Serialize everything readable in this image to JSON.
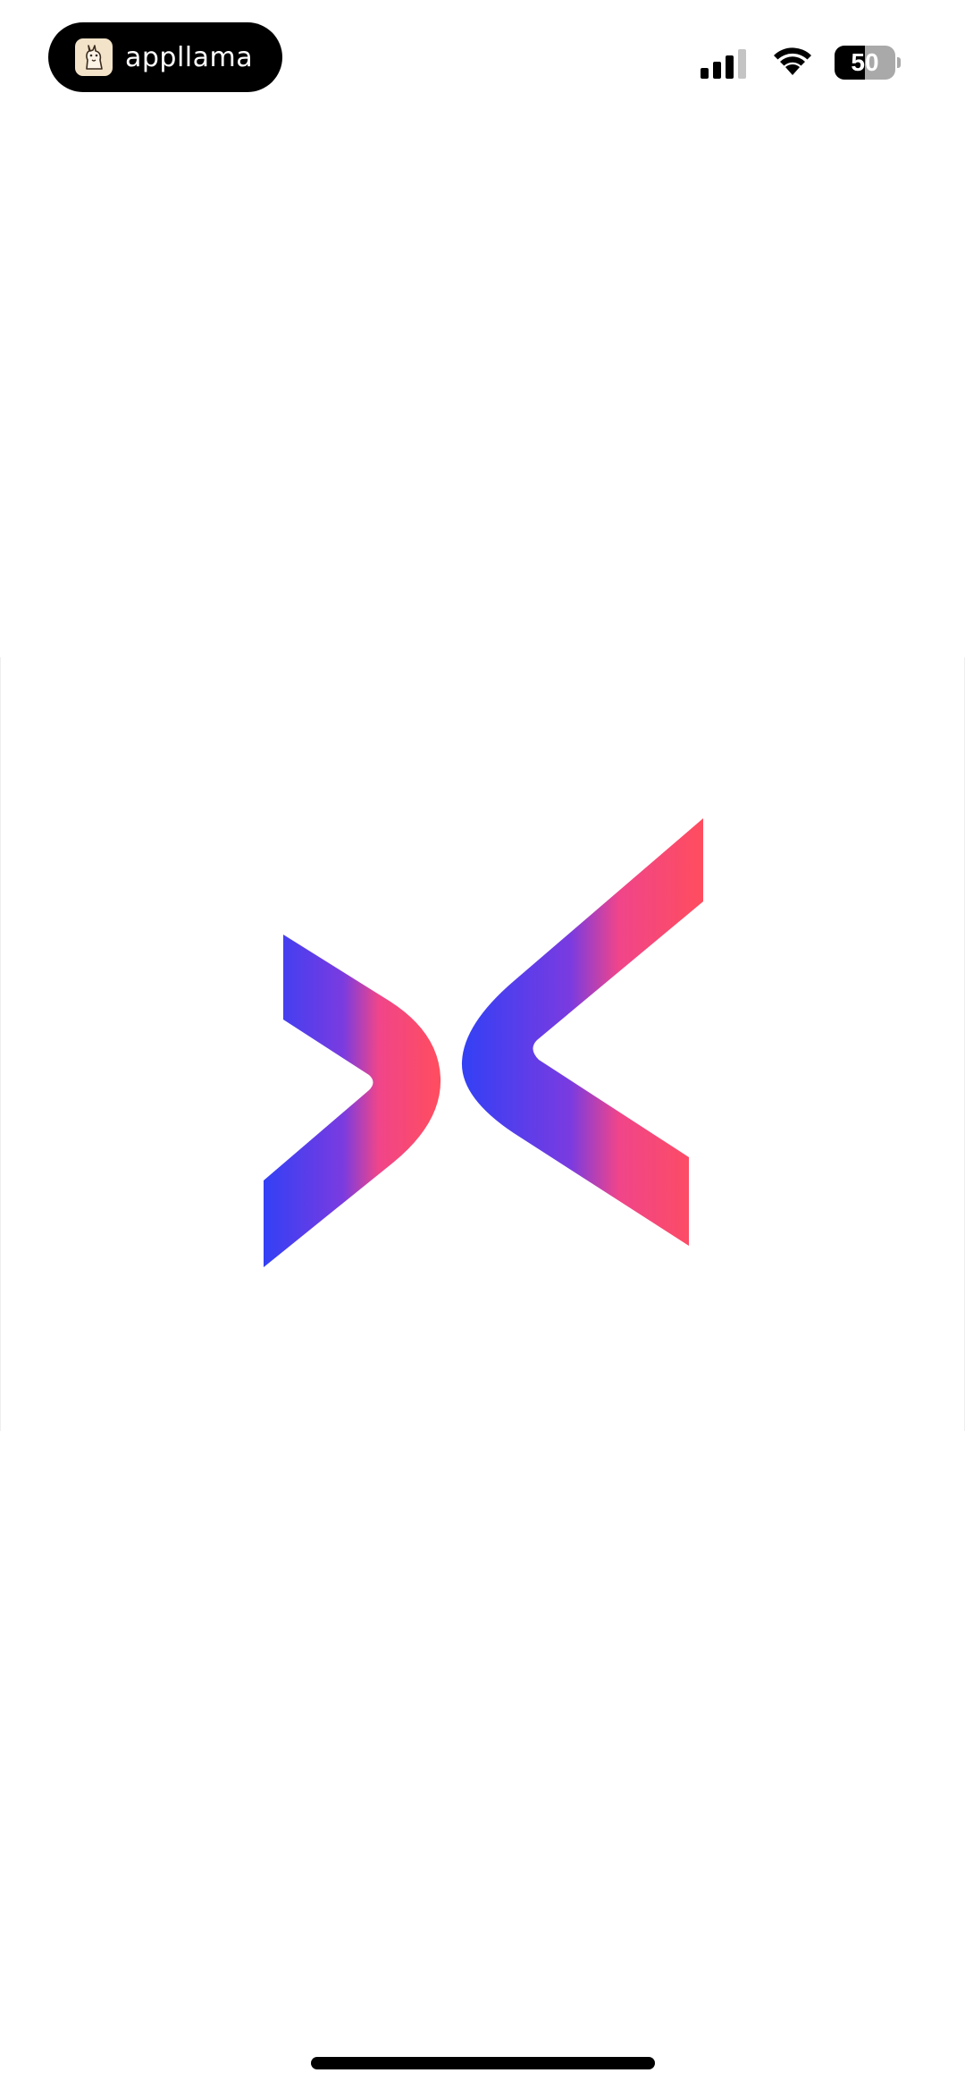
{
  "status_bar": {
    "app_name": "appllama",
    "app_icon": "llama-icon",
    "signal_bars_active": 3,
    "signal_bars_total": 4,
    "wifi_icon": "wifi-icon",
    "battery_level": "50",
    "battery_percent": 50
  },
  "splash": {
    "logo_icon": "x-chevrons-logo",
    "gradient_start": "#3340f5",
    "gradient_mid": "#7a3be0",
    "gradient_end": "#ff4d5e"
  },
  "colors": {
    "background": "#ffffff",
    "pill": "#000000",
    "battery_track": "#a9a9a9"
  }
}
